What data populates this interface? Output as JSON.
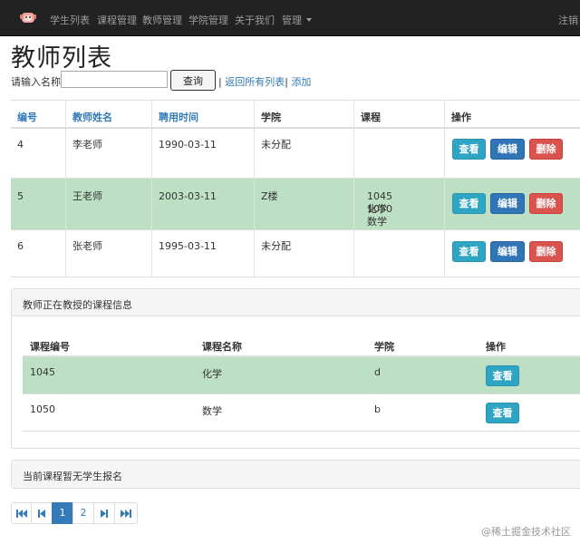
{
  "navbar": {
    "brand_icon": "mascot-logo-icon",
    "links": [
      "学生列表",
      "课程管理",
      "教师管理",
      "学院管理",
      "关于我们",
      "管理"
    ],
    "right_text": "注销"
  },
  "page_title": "教师列表",
  "search": {
    "label": "请输入名称",
    "input_value": "",
    "input_placeholder": "",
    "button_label": "查询",
    "separator": "|",
    "return_all": "返回所有列表",
    "separator2": "|",
    "add": "添加"
  },
  "teacher_table": {
    "headers": [
      "编号",
      "教师姓名",
      "聘用时间",
      "学院",
      "课程",
      "操作"
    ],
    "rows": [
      {
        "id": "4",
        "name": "李老师",
        "hire_date": "1990-03-11",
        "college": "未分配",
        "course_line1": "",
        "course_line2": "",
        "highlight": false
      },
      {
        "id": "5",
        "name": "王老师",
        "hire_date": "2003-03-11",
        "college": "Z楼",
        "course_line1": "1045 化学",
        "course_line2": "1050 数学",
        "highlight": true
      },
      {
        "id": "6",
        "name": "张老师",
        "hire_date": "1995-03-11",
        "college": "未分配",
        "course_line1": "",
        "course_line2": "",
        "highlight": false
      }
    ],
    "actions": {
      "view": "查看",
      "edit": "编辑",
      "delete": "删除"
    }
  },
  "course_panel": {
    "heading": "教师正在教授的课程信息",
    "headers": [
      "课程编号",
      "课程名称",
      "学院",
      "操作"
    ],
    "rows": [
      {
        "code": "1045",
        "name": "化学",
        "college": "d",
        "highlight": true
      },
      {
        "code": "1050",
        "name": "数学",
        "college": "b",
        "highlight": false
      }
    ],
    "view_label": "查看"
  },
  "student_panel": {
    "heading": "当前课程暂无学生报名"
  },
  "pagination": {
    "first_icon": "first-page-icon",
    "prev_icon": "prev-page-icon",
    "pages": [
      "1",
      "2"
    ],
    "active_page": "1",
    "next_icon": "next-page-icon",
    "last_icon": "last-page-icon"
  },
  "watermark": "@稀土掘金技术社区",
  "colors": {
    "navbar_bg": "#222222",
    "link": "#337ab7",
    "success_row": "#bde0c4",
    "btn_info": "#2da5c3",
    "btn_primary": "#2f75b7",
    "btn_danger": "#d9534f"
  }
}
